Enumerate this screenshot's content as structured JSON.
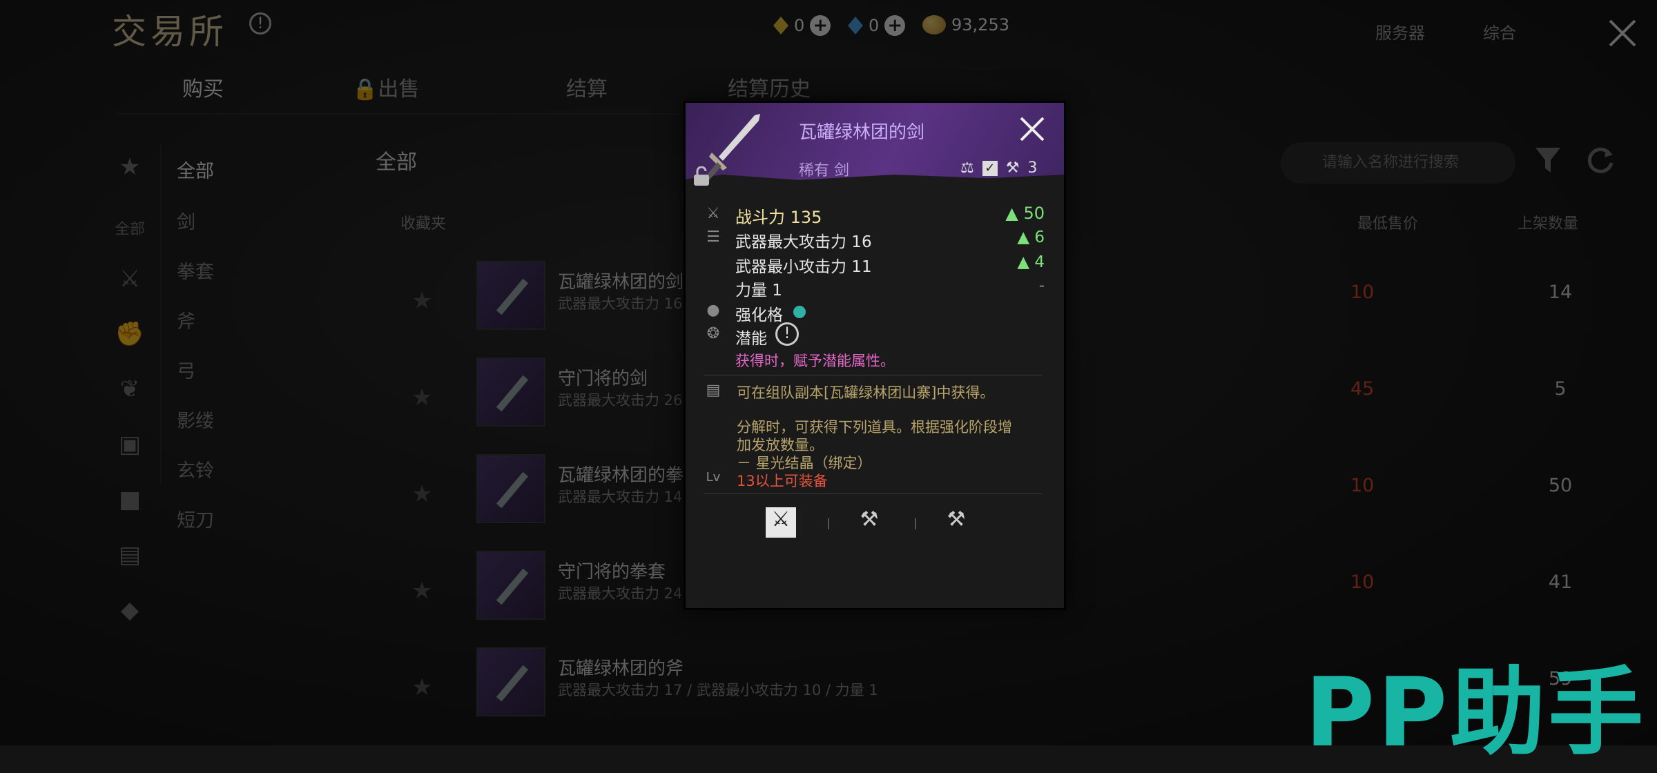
{
  "header": {
    "title": "交易所",
    "currencies": [
      {
        "icon": "yellow-gem-icon",
        "value": "0",
        "color": "#e6c23a"
      },
      {
        "icon": "blue-gem-icon",
        "value": "0",
        "color": "#4aa3e8"
      },
      {
        "icon": "gold-coin-icon",
        "value": "93,253"
      }
    ],
    "server_label": "服务器",
    "overall_label": "综合"
  },
  "tabs": [
    {
      "label": "购买",
      "active": true
    },
    {
      "label": "出售",
      "locked": true
    },
    {
      "label": "结算"
    },
    {
      "label": "结算历史"
    }
  ],
  "sidebar": {
    "icon_label": "全部",
    "categories": [
      {
        "label": "全部",
        "active": true
      },
      {
        "label": "剑"
      },
      {
        "label": "拳套"
      },
      {
        "label": "斧"
      },
      {
        "label": "弓"
      },
      {
        "label": "影缕"
      },
      {
        "label": "玄铃"
      },
      {
        "label": "短刀"
      }
    ]
  },
  "list": {
    "heading": "全部",
    "search_placeholder": "请输入名称进行搜索",
    "col_fav": "收藏夹",
    "col_price": "最低售价",
    "col_qty": "上架数量",
    "rows": [
      {
        "name": "瓦罐绿林团的剑",
        "desc": "武器最大攻击力 16",
        "price": "10",
        "qty": "14"
      },
      {
        "name": "守门将的剑",
        "desc": "武器最大攻击力 26",
        "price": "45",
        "qty": "5"
      },
      {
        "name": "瓦罐绿林团的拳套",
        "desc": "武器最大攻击力 14",
        "price": "10",
        "qty": "50"
      },
      {
        "name": "守门将的拳套",
        "desc": "武器最大攻击力 24",
        "price": "10",
        "qty": "41"
      },
      {
        "name": "瓦罐绿林团的斧",
        "desc": "武器最大攻击力 17 / 武器最小攻击力 10 / 力量 1",
        "price": "",
        "qty": "59"
      }
    ]
  },
  "popup": {
    "name": "瓦罐绿林团的剑",
    "rarity": "稀有 剑",
    "trade_count": "3",
    "combat_power": "战斗力 135",
    "combat_gain": "50",
    "stats": [
      {
        "label": "武器最大攻击力 16",
        "gain": "6"
      },
      {
        "label": "武器最小攻击力 11",
        "gain": "4"
      },
      {
        "label": "力量 1",
        "gain": "-"
      }
    ],
    "enhance_label": "强化格",
    "potential_label": "潜能",
    "potential_note": "获得时，赋予潜能属性。",
    "source_text": "可在组队副本[瓦罐绿林团山寨]中获得。",
    "dismantle_line1": "分解时，可获得下列道具。根据强化阶段增",
    "dismantle_line2": "加发放数量。",
    "dismantle_item": "－ 星光结晶（绑定）",
    "level_req": "13以上可装备",
    "colors": {
      "rare": "#c9aef7",
      "gain": "#7ee07a",
      "potential": "#e468c8",
      "level": "#e4533c",
      "source": "#b8a46a"
    }
  },
  "watermark": "PP助手"
}
